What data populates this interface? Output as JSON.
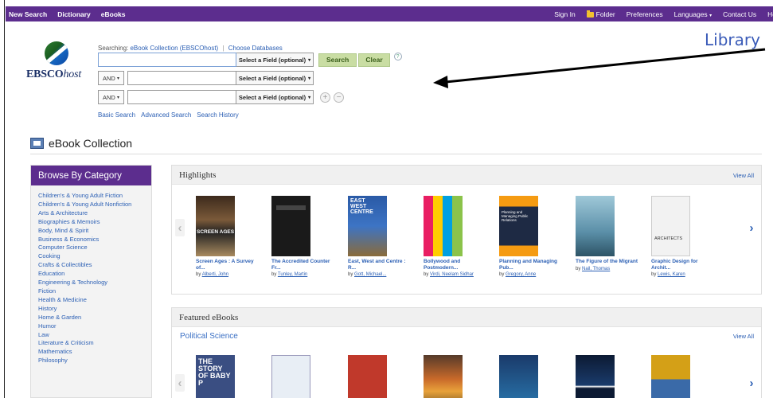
{
  "topnav": {
    "left": [
      "New Search",
      "Dictionary",
      "eBooks"
    ],
    "sign_in": "Sign In",
    "folder": "Folder",
    "preferences": "Preferences",
    "languages": "Languages",
    "contact": "Contact Us",
    "help": "He"
  },
  "logo": {
    "brand": "EBSCO",
    "brand_suffix": "host"
  },
  "search": {
    "searching_label": "Searching:",
    "database": "eBook Collection (EBSCOhost)",
    "choose": "Choose Databases",
    "field_select": "Select a Field (optional)",
    "bool1": "AND",
    "bool2": "AND",
    "search_button": "Search",
    "clear_button": "Clear",
    "help": "?",
    "add": "+",
    "remove": "−",
    "links": [
      "Basic Search",
      "Advanced Search",
      "Search History"
    ]
  },
  "library_label": "Library",
  "collection_title": "eBook Collection",
  "sidebar": {
    "heading": "Browse By Category",
    "categories": [
      "Children's & Young Adult Fiction",
      "Children's & Young Adult Nonfiction",
      "Arts & Architecture",
      "Biographies & Memoirs",
      "Body, Mind & Spirit",
      "Business & Economics",
      "Computer Science",
      "Cooking",
      "Crafts & Collectibles",
      "Education",
      "Engineering & Technology",
      "Fiction",
      "Health & Medicine",
      "History",
      "Home & Garden",
      "Humor",
      "Law",
      "Literature & Criticism",
      "Mathematics",
      "Philosophy"
    ]
  },
  "highlights": {
    "heading": "Highlights",
    "view_all": "View All",
    "prev": "‹",
    "next": "›",
    "books": [
      {
        "title": "Screen Ages : A Survey of...",
        "by": "by",
        "author": "Alberti, John"
      },
      {
        "title": "The Accredited Counter Fr...",
        "by": "by",
        "author": "Tunley, Martin"
      },
      {
        "title": "East, West and Centre : R...",
        "by": "by",
        "author": "Gott, Michael..."
      },
      {
        "title": "Bollywood and Postmodern...",
        "by": "by",
        "author": "Virdi, Neelam Sidhar"
      },
      {
        "title": "Planning and Managing Pub...",
        "by": "by",
        "author": "Gregory, Anne"
      },
      {
        "title": "The Figure of the Migrant",
        "by": "by",
        "author": "Nail, Thomas"
      },
      {
        "title": "Graphic Design for Archit...",
        "by": "by",
        "author": "Lewis, Karen"
      }
    ]
  },
  "featured": {
    "heading": "Featured eBooks",
    "subheading": "Political Science",
    "view_all": "View All",
    "prev": "‹",
    "next": "›"
  }
}
